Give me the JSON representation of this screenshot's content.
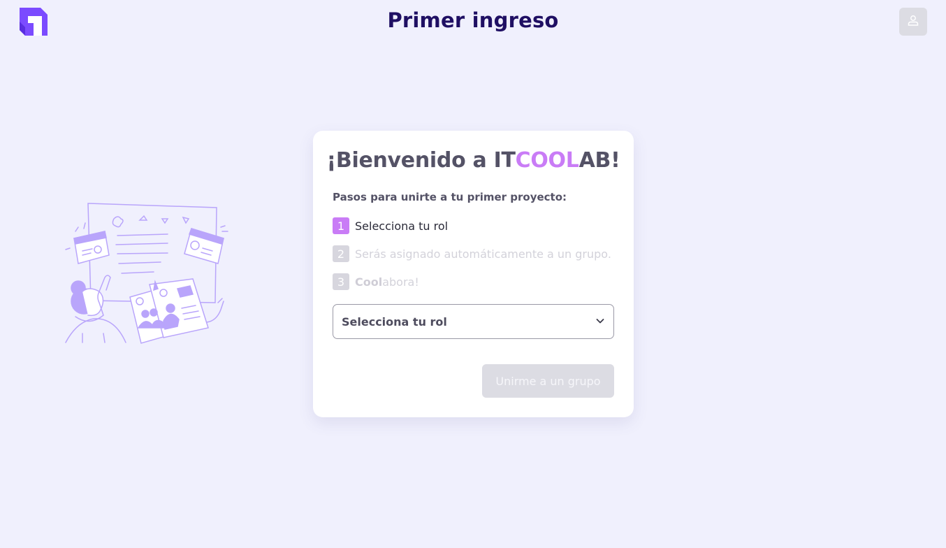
{
  "header": {
    "title": "Primer ingreso",
    "logo_icon": "app-logo-icon",
    "profile_icon": "user-icon"
  },
  "card": {
    "welcome_prefix": "¡Bienvenido a IT",
    "welcome_accent": "COOL",
    "welcome_suffix": "AB!",
    "steps_title": "Pasos para unirte a tu primer proyecto:",
    "steps": [
      {
        "number": "1",
        "text": "Selecciona tu rol",
        "state": "active"
      },
      {
        "number": "2",
        "text": "Serás asignado automáticamente a un grupo.",
        "state": "pending"
      },
      {
        "number": "3",
        "text_bold": "Cool",
        "text": "abora!",
        "state": "pending"
      }
    ],
    "role_select": {
      "value": "Selecciona tu rol",
      "icon": "chevron-down-icon"
    },
    "join_button": {
      "label": "Unirme a un grupo",
      "enabled": false
    }
  },
  "colors": {
    "background": "#f0f0fd",
    "title": "#1f0f63",
    "accent": "#c97cf6",
    "logo": "#7b4bff",
    "illustration": "#b9a5fb",
    "disabled": "#dcdce3"
  }
}
